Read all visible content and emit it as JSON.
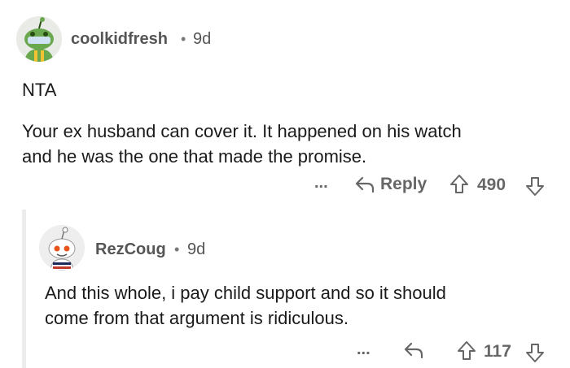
{
  "comment": {
    "username": "coolkidfresh",
    "separator": "•",
    "age": "9d",
    "lines": [
      "NTA",
      "Your ex husband can cover it. It happened on his watch",
      "and he was the one that made the promise."
    ],
    "actions": {
      "more": "...",
      "reply": "Reply",
      "score": "490"
    }
  },
  "reply": {
    "username": "RezCoug",
    "separator": "•",
    "age": "9d",
    "lines": [
      "And this whole, i pay child support and so it should",
      "come from that argument is ridiculous."
    ],
    "actions": {
      "more": "...",
      "score": "117"
    }
  },
  "colors": {
    "text": "#1a1a1b",
    "meta": "#555555",
    "icon": "#666666",
    "thread_line": "#ececec",
    "avatar1_bg": "#e9ebe7",
    "avatar2_bg": "#eeeeee"
  }
}
